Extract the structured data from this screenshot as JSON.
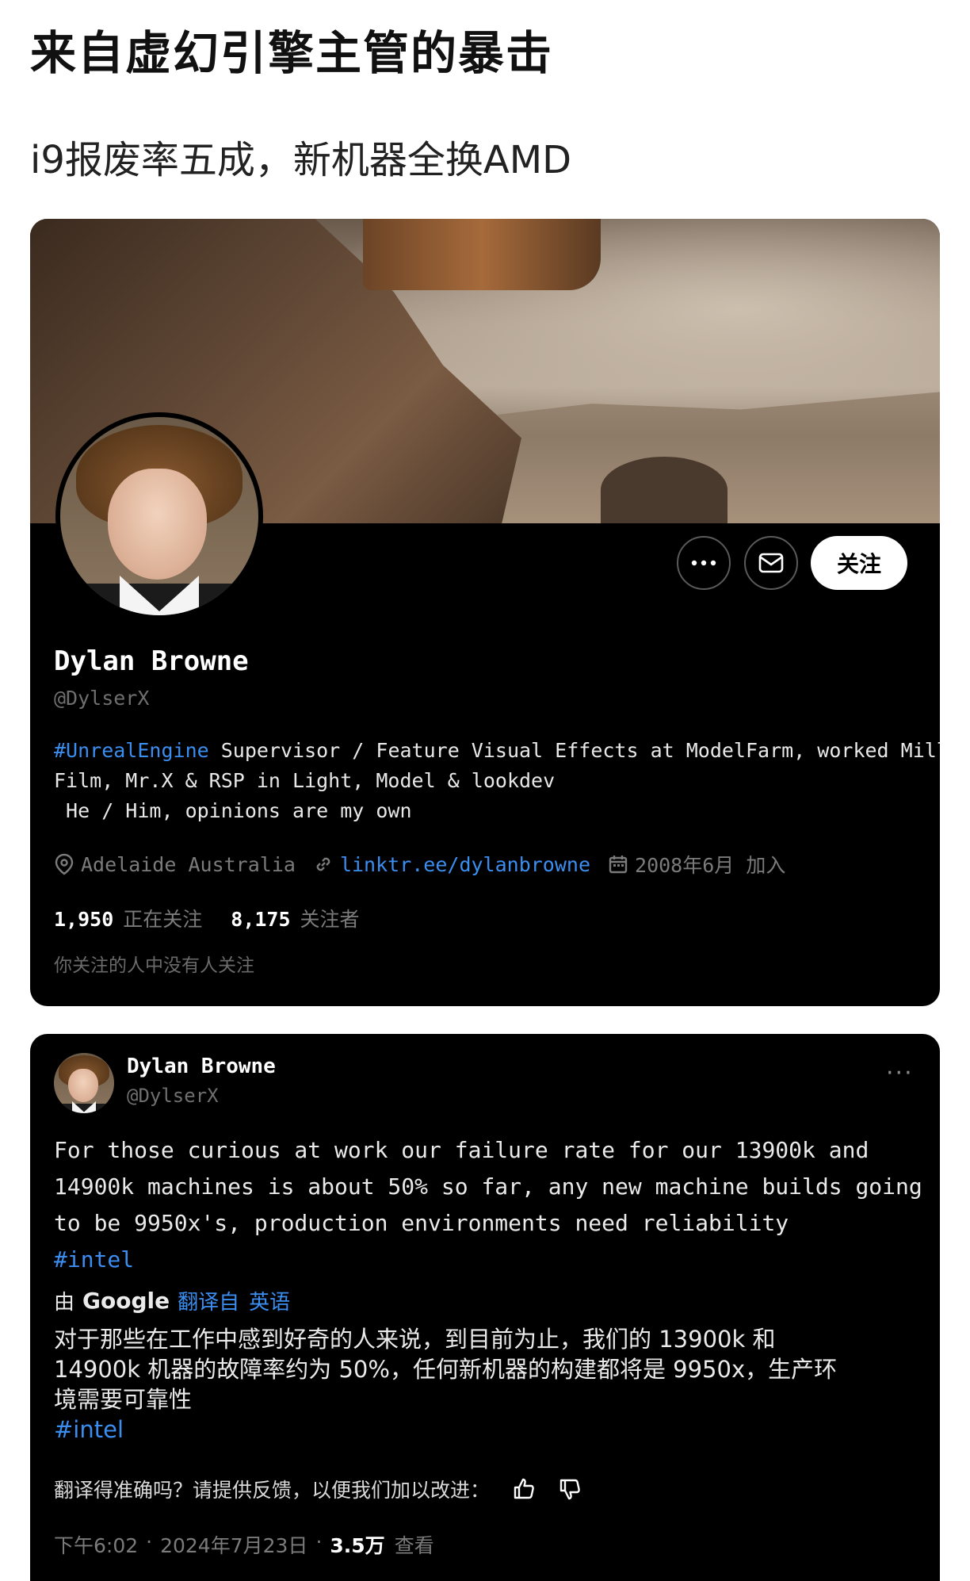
{
  "article": {
    "title": "来自虚幻引擎主管的暴击",
    "subtitle": "i9报废率五成，新机器全换AMD"
  },
  "profile": {
    "display_name": "Dylan Browne",
    "handle": "@DylserX",
    "buttons": {
      "more_icon": "more-horizontal-icon",
      "message_icon": "mail-icon",
      "follow_label": "关注"
    },
    "bio": {
      "hashtag": "#UnrealEngine",
      "line1_rest": " Supervisor / Feature Visual Effects at ModelFarm, worked Mill",
      "line2": "Film, Mr.X & RSP in Light, Model & lookdev",
      "line3": " He / Him, opinions are my own"
    },
    "location": "Adelaide Australia",
    "link": "linktr.ee/dylanbrowne",
    "joined": "2008年6月 加入",
    "following_count": "1,950",
    "following_label": "正在关注",
    "followers_count": "8,175",
    "followers_label": "关注者",
    "mutual_note": "你关注的人中没有人关注"
  },
  "tweet": {
    "author_name": "Dylan Browne",
    "author_handle": "@DylserX",
    "more_glyph": "···",
    "text_lines": [
      "For those curious at work our failure rate for our 13900k and",
      "14900k machines is about 50% so far, any new machine builds going",
      "to be 9950x's, production environments need reliability"
    ],
    "hashtag": "#intel",
    "translate": {
      "by_label": "由",
      "provider": "Google",
      "from_link": "翻译自",
      "language": "英语"
    },
    "translated_lines": [
      "对于那些在工作中感到好奇的人来说，到目前为止，我们的 13900k 和",
      "14900k 机器的故障率约为 50%，任何新机器的构建都将是 9950x，生产环",
      "境需要可靠性"
    ],
    "translated_hashtag": "#intel",
    "feedback_prompt": "翻译得准确吗？请提供反馈，以便我们加以改进：",
    "time": "下午6:02",
    "date": "2024年7月23日",
    "views_count": "3.5万",
    "views_label": "查看"
  }
}
